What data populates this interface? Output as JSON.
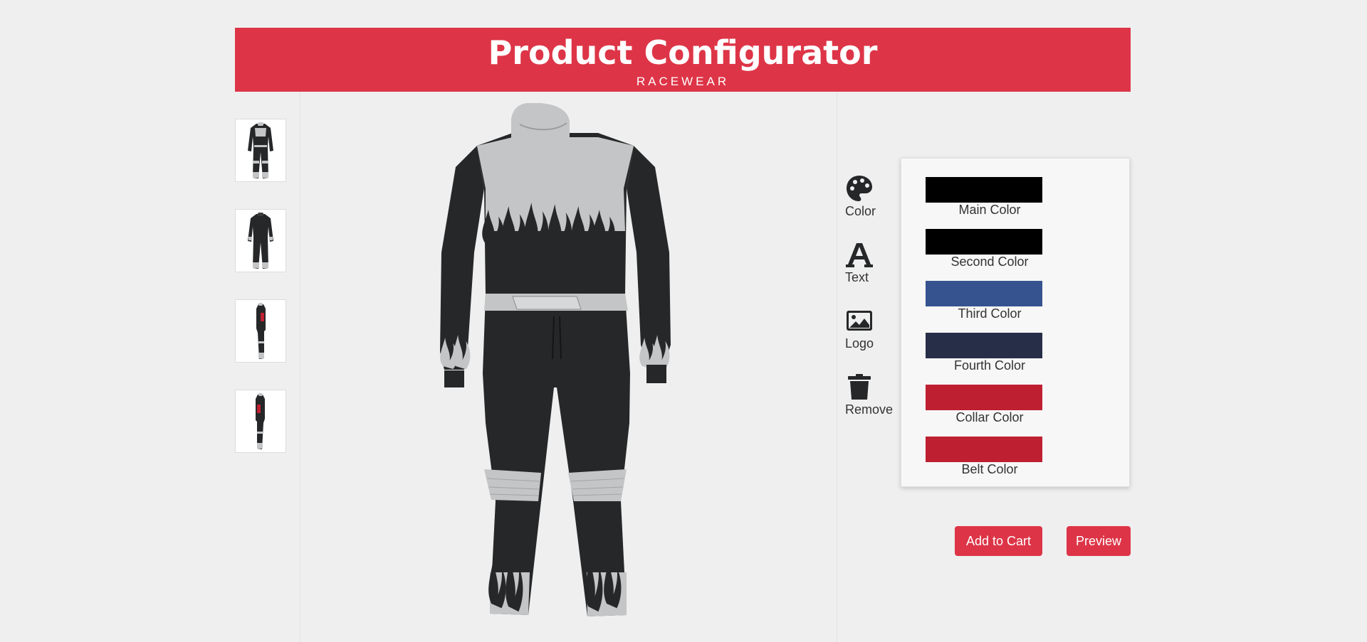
{
  "header": {
    "title": "Product Configurator",
    "subtitle": "RACEWEAR"
  },
  "thumbnails": [
    {
      "view": "front"
    },
    {
      "view": "back"
    },
    {
      "view": "left-side"
    },
    {
      "view": "right-side"
    }
  ],
  "tools": [
    {
      "icon": "palette-icon",
      "label": "Color"
    },
    {
      "icon": "text-icon",
      "label": "Text"
    },
    {
      "icon": "image-icon",
      "label": "Logo"
    },
    {
      "icon": "trash-icon",
      "label": "Remove"
    }
  ],
  "colors": [
    {
      "label": "Main Color",
      "value": "#000000"
    },
    {
      "label": "Second Color",
      "value": "#000000"
    },
    {
      "label": "Third Color",
      "value": "#365390"
    },
    {
      "label": "Fourth Color",
      "value": "#272e47"
    },
    {
      "label": "Collar Color",
      "value": "#bf2031"
    },
    {
      "label": "Belt Color",
      "value": "#bf2031"
    }
  ],
  "actions": {
    "add_to_cart": "Add to Cart",
    "preview": "Preview"
  },
  "theme": {
    "accent": "#dd3547",
    "background": "#efefef",
    "suit_dark": "#262728",
    "suit_light": "#c4c5c6"
  }
}
